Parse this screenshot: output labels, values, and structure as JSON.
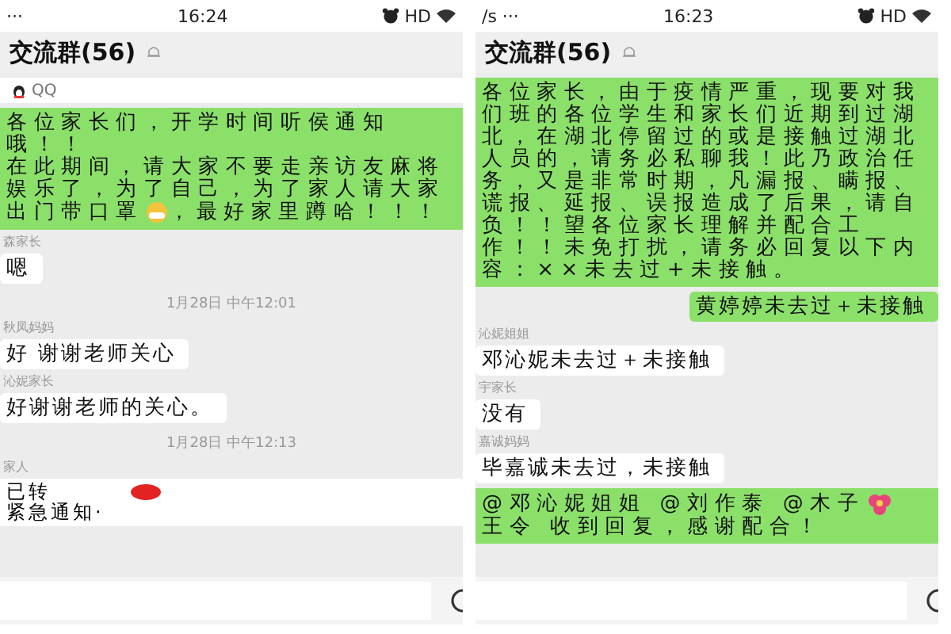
{
  "panels": [
    {
      "status": {
        "left": "···",
        "time": "16:24",
        "network": "HD"
      },
      "title": "交流群(56)",
      "messages": [
        {
          "kind": "banner",
          "text": "QQ"
        },
        {
          "kind": "notice_with_face",
          "lines": [
            "各位家长们，开学时间听侯通知哦！！",
            "在此期间，请大家不要走亲访友麻将娱乐了，为了自己，为了家人请大家出门带口罩"
          ],
          "text_after": "，最好家里蹲哈！！！"
        },
        {
          "kind": "incoming",
          "sender": "森家长",
          "text": "嗯"
        },
        {
          "kind": "time",
          "text": "1月28日 中午12:01"
        },
        {
          "kind": "incoming",
          "sender": "秋凤妈妈",
          "text": "好 谢谢老师关心"
        },
        {
          "kind": "incoming",
          "sender": "沁妮家长",
          "text": "好谢谢老师的关心。"
        },
        {
          "kind": "time",
          "text": "1月28日 中午12:13"
        },
        {
          "kind": "forward",
          "sender": "家人",
          "text": "已转",
          "text_after": "紧急通知·"
        }
      ]
    },
    {
      "status": {
        "left": "/s ···",
        "time": "16:23",
        "network": "HD"
      },
      "title": "交流群(56)",
      "messages": [
        {
          "kind": "notice",
          "lines": [
            "各位家长，由于疫情严重，现要对我们班的各位学生和家长们近期到过湖北，在湖北停留过的或是接触过湖北人员的，请务必私聊我！此乃政治任务，又是非常时期，凡漏报、瞒报、谎报、延报、误报造成了后果，请自负！！望各位家长理解并配合工作！！未免打扰，请务必回复以下内容：××未去过+未接触。"
          ]
        },
        {
          "kind": "outgoing",
          "text": "黄婷婷未去过＋未接触"
        },
        {
          "kind": "incoming",
          "sender": "沁妮姐姐",
          "text": "邓沁妮未去过＋未接触"
        },
        {
          "kind": "incoming",
          "sender": "宇家长",
          "text": "没有"
        },
        {
          "kind": "incoming",
          "sender": "嘉诚妈妈",
          "text": "毕嘉诚未去过，未接触"
        },
        {
          "kind": "notice_with_flower",
          "lines": [
            "@邓沁妮姐姐 @刘作泰 @木子",
            "王令 收到回复，感谢配合！"
          ]
        }
      ]
    }
  ]
}
